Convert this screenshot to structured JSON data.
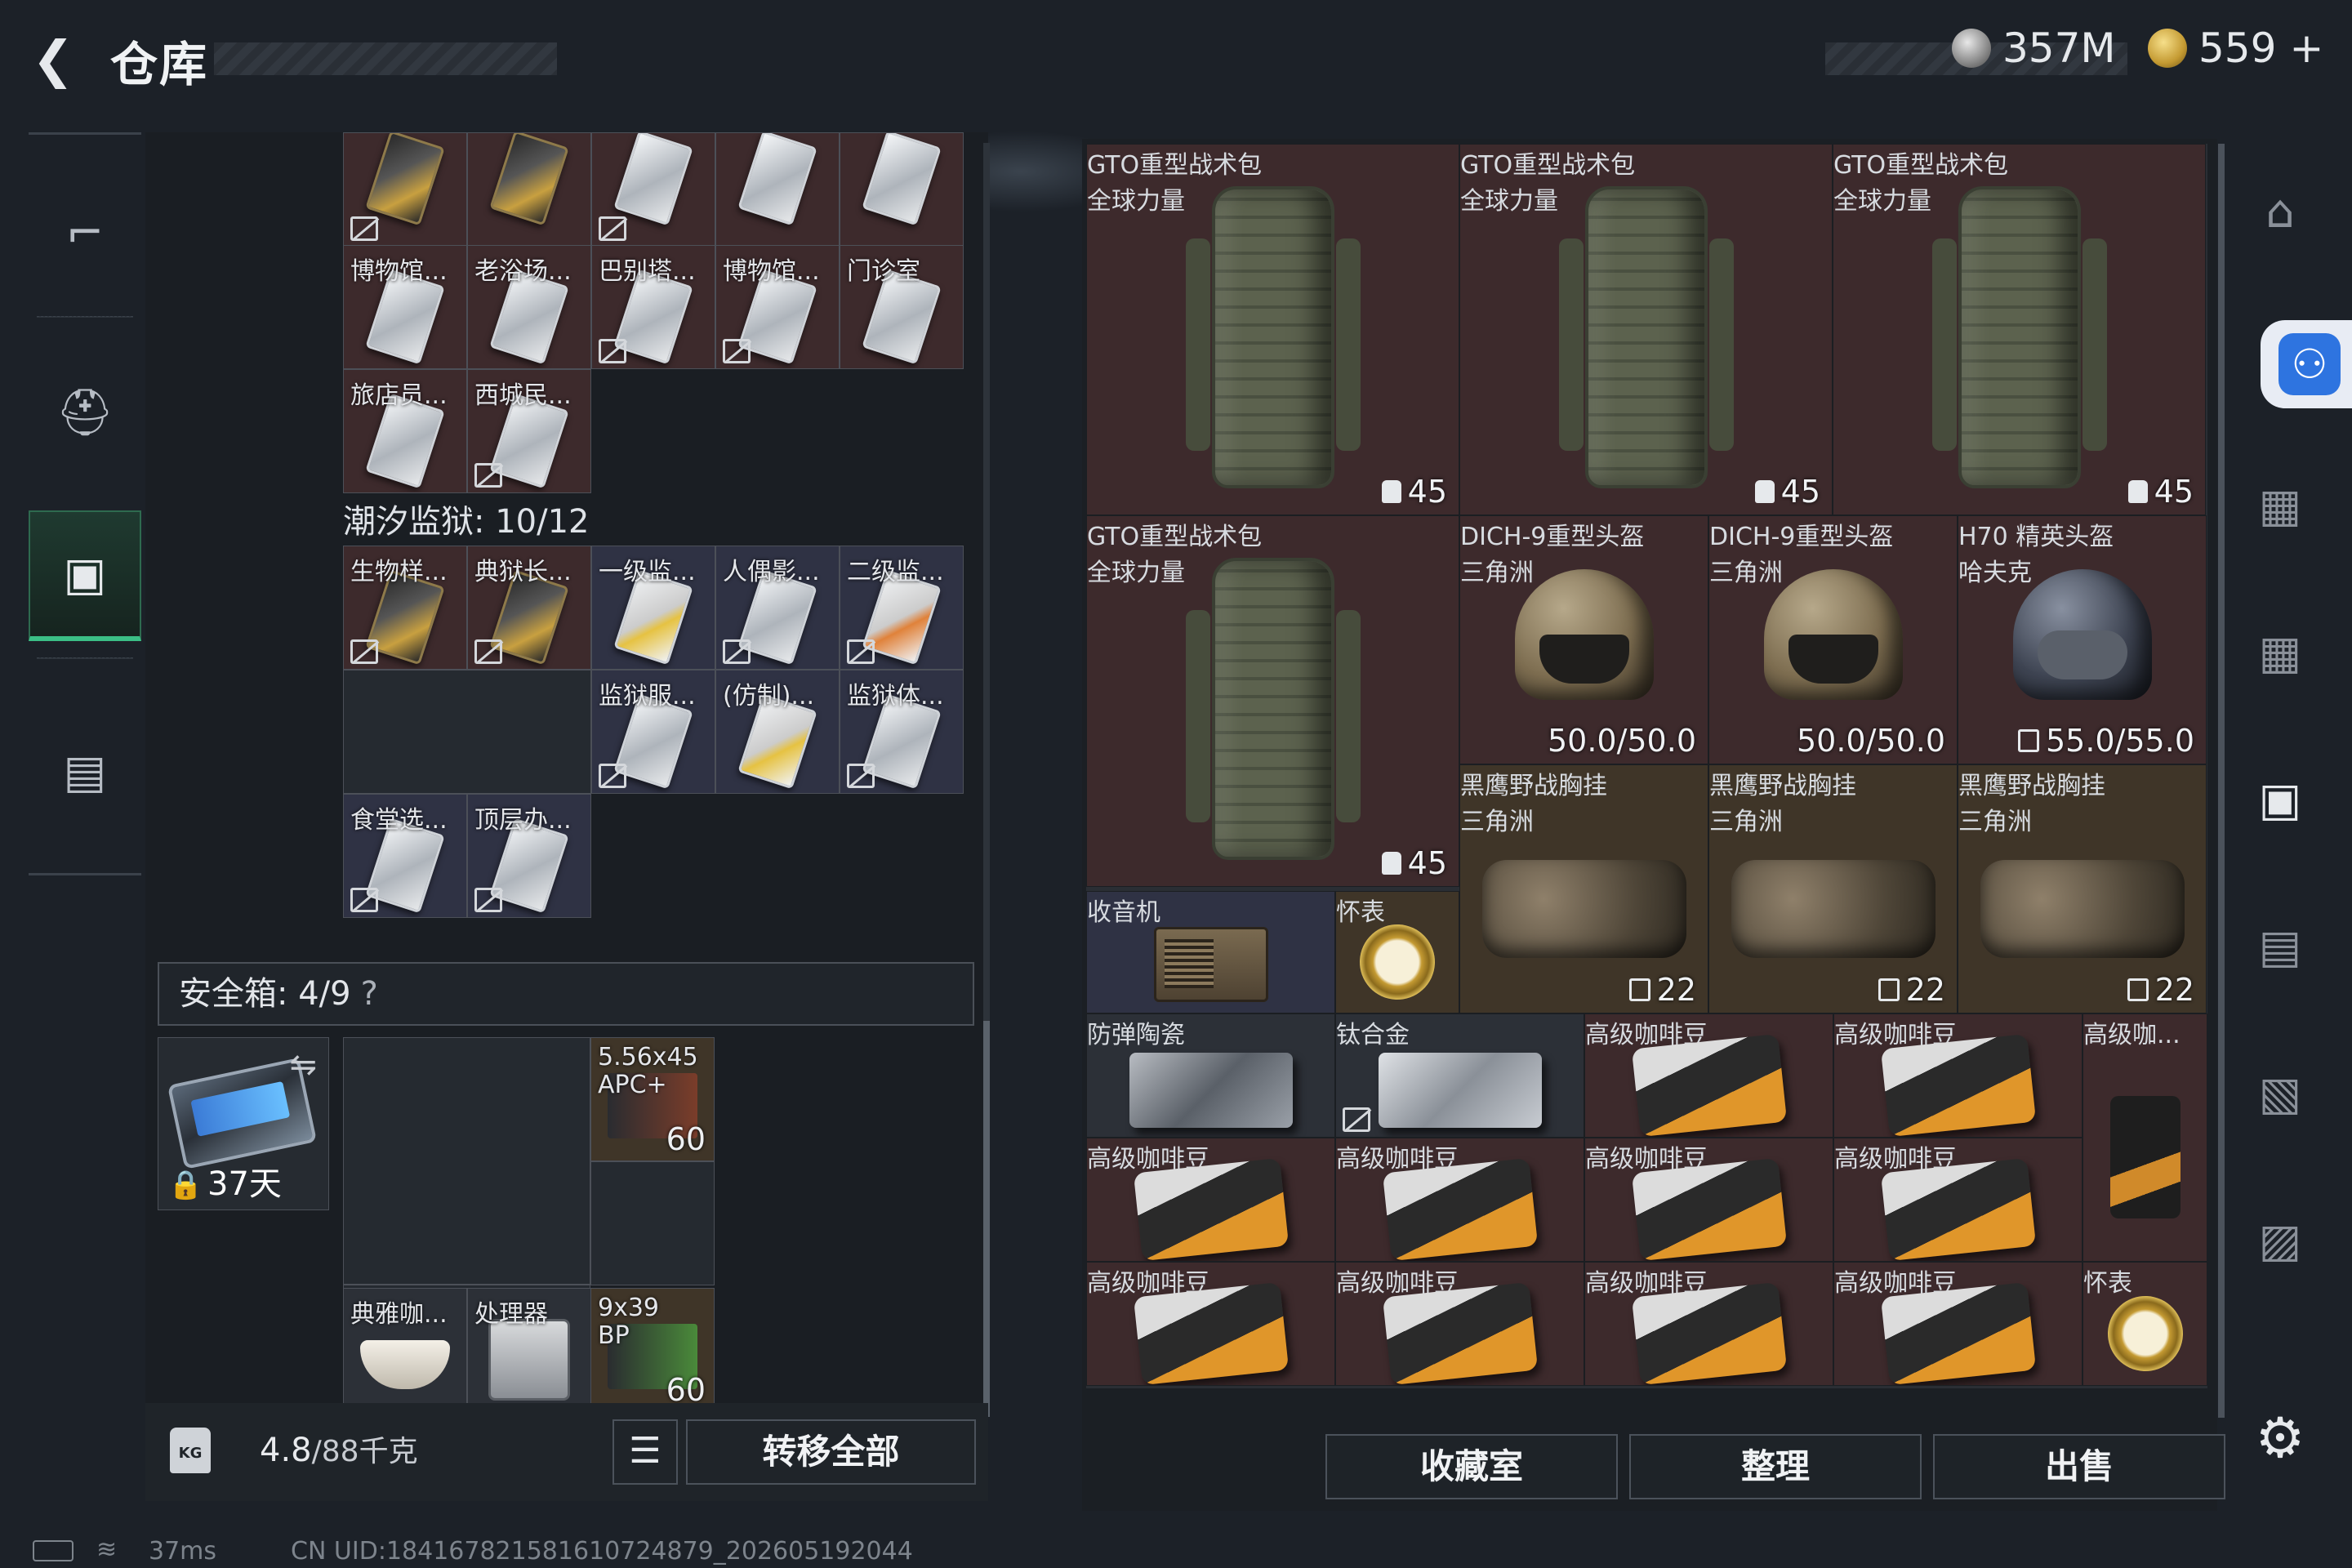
{
  "header": {
    "title": "仓库",
    "back_icon": "back-arrow-icon",
    "currency1": {
      "icon": "silver-coin-icon",
      "value": "357M"
    },
    "currency2": {
      "icon": "gold-coin-icon",
      "value": "559",
      "plus": "+"
    }
  },
  "leftnav": {
    "items": [
      {
        "icon": "gun-icon",
        "glyph": "⌐"
      },
      {
        "icon": "backpack-icon",
        "glyph": "⛑"
      },
      {
        "icon": "vest-icon",
        "glyph": "▣",
        "active": true
      },
      {
        "icon": "toolbox-icon",
        "glyph": "🧰"
      }
    ]
  },
  "left_grid": {
    "row_top_labels": [
      "",
      "",
      "",
      "",
      ""
    ],
    "row1": [
      {
        "label": "博物馆...",
        "card": "silver",
        "nobind": false
      },
      {
        "label": "老浴场...",
        "card": "silver",
        "nobind": false
      },
      {
        "label": "巴别塔...",
        "card": "silver",
        "nobind": true
      },
      {
        "label": "博物馆...",
        "card": "silver",
        "nobind": true
      },
      {
        "label": "门诊室",
        "card": "silver",
        "nobind": false
      }
    ],
    "row2": [
      {
        "label": "旅店员...",
        "card": "silver",
        "nobind": false
      },
      {
        "label": "西城民...",
        "card": "silver",
        "nobind": true
      }
    ],
    "tide": {
      "label": "潮汐监狱: 10/12"
    },
    "row3": [
      {
        "label": "生物样...",
        "card": "gold",
        "nobind": true
      },
      {
        "label": "典狱长...",
        "card": "gold",
        "nobind": true
      },
      {
        "label": "一级监...",
        "card": "yellow",
        "nobind": false
      },
      {
        "label": "人偶影...",
        "card": "silver",
        "nobind": true
      },
      {
        "label": "二级监...",
        "card": "orange",
        "nobind": true
      }
    ],
    "row4": [
      {
        "label": "监狱服...",
        "card": "silver",
        "nobind": true
      },
      {
        "label": "(仿制)...",
        "card": "yellow",
        "nobind": false
      },
      {
        "label": "监狱体...",
        "card": "silver",
        "nobind": true
      }
    ],
    "row5": [
      {
        "label": "食堂选...",
        "card": "silver",
        "nobind": true
      },
      {
        "label": "顶层办...",
        "card": "silver",
        "nobind": true
      }
    ]
  },
  "safebox": {
    "label": "安全箱: 4/9",
    "help": "?",
    "container_days": "37天",
    "ammo1": {
      "label1": "5.56x45",
      "label2": "APC+",
      "count": "60"
    },
    "coffee": {
      "label": "典雅咖..."
    },
    "cpu": {
      "label": "处理器"
    },
    "ammo2": {
      "label1": "9x39",
      "label2": "BP",
      "count": "60"
    }
  },
  "bottom_left": {
    "weight": "4.8",
    "weight_unit": "/88千克",
    "transfer_label": "转移全部",
    "list_icon": "list-icon",
    "kg_icon": "KG"
  },
  "right_grid": {
    "packs": [
      {
        "line1": "GTO重型战术包",
        "line2": "全球力量",
        "capacity": "45"
      },
      {
        "line1": "GTO重型战术包",
        "line2": "全球力量",
        "capacity": "45"
      },
      {
        "line1": "GTO重型战术包",
        "line2": "全球力量",
        "capacity": "45"
      },
      {
        "line1": "GTO重型战术包",
        "line2": "全球力量",
        "capacity": "45"
      }
    ],
    "helmets": [
      {
        "line1": "DICH-9重型头盔",
        "line2": "三角洲",
        "durability": "50.0/50.0"
      },
      {
        "line1": "DICH-9重型头盔",
        "line2": "三角洲",
        "durability": "50.0/50.0"
      },
      {
        "line1": "H70 精英头盔",
        "line2": "哈夫克",
        "durability": "55.0/55.0"
      }
    ],
    "rigs": [
      {
        "line1": "黑鹰野战胸挂",
        "line2": "三角洲",
        "capacity": "22"
      },
      {
        "line1": "黑鹰野战胸挂",
        "line2": "三角洲",
        "capacity": "22"
      },
      {
        "line1": "黑鹰野战胸挂",
        "line2": "三角洲",
        "capacity": "22"
      }
    ],
    "radio": "收音机",
    "watch1": "怀表",
    "plate1": "防弹陶瓷",
    "plate2": "钛合金",
    "coffee_label": "高级咖啡豆",
    "coffee_short": "高级咖...",
    "watch2": "怀表"
  },
  "right_buttons": {
    "collection": "收藏室",
    "sort": "整理",
    "sell": "出售"
  },
  "status": {
    "ping": "37ms",
    "uid": "CN UID:1841678215816107248​79_202605192044"
  }
}
